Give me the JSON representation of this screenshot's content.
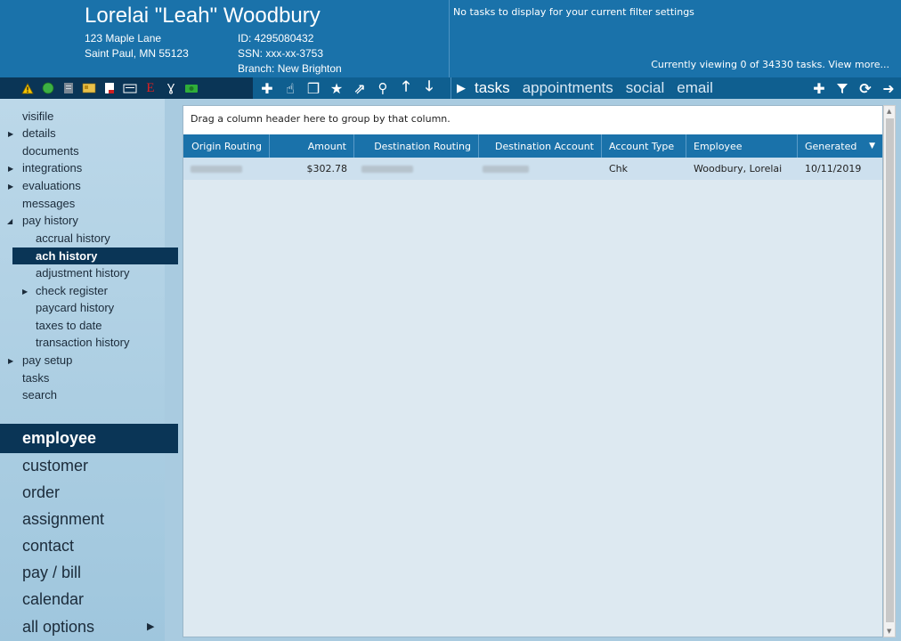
{
  "employee": {
    "name": "Lorelai \"Leah\" Woodbury",
    "address1": "123 Maple Lane",
    "address2": "Saint Paul, MN 55123",
    "id": "ID: 4295080432",
    "ssn": "SSN: xxx-xx-3753",
    "branch": "Branch:  New Brighton"
  },
  "tasks": {
    "message": "No tasks to display for your current filter settings",
    "count_text": "Currently viewing 0 of 34330 tasks. View more...",
    "tabs": [
      "tasks",
      "appointments",
      "social",
      "email"
    ]
  },
  "sidebar": {
    "items": [
      "visifile",
      "details",
      "documents",
      "integrations",
      "evaluations",
      "messages",
      "pay history"
    ],
    "sub_items": [
      "accrual history",
      "ach history",
      "adjustment history",
      "check register",
      "paycard history",
      "taxes to date",
      "transaction history"
    ],
    "items_after": [
      "pay setup",
      "tasks",
      "search"
    ],
    "main_nav": [
      "employee",
      "customer",
      "order",
      "assignment",
      "contact",
      "pay / bill",
      "calendar",
      "all options"
    ],
    "more_arrow": "▶"
  },
  "grid": {
    "group_hint": "Drag a column header here to group by that column.",
    "columns": [
      "Origin Routing",
      "Amount",
      "Destination Routing",
      "Destination Account",
      "Account Type",
      "Employee",
      "Generated"
    ],
    "rows": [
      {
        "origin_routing": "",
        "amount": "$302.78",
        "destination_routing": "",
        "destination_account": "",
        "account_type": "Chk",
        "employee": "Woodbury, Lorelai",
        "generated": "10/11/2019"
      }
    ]
  },
  "colors": {
    "header_blue": "#1a72aa",
    "dark_navy": "#0a3556",
    "sidebar_light": "#bcd8e9"
  }
}
